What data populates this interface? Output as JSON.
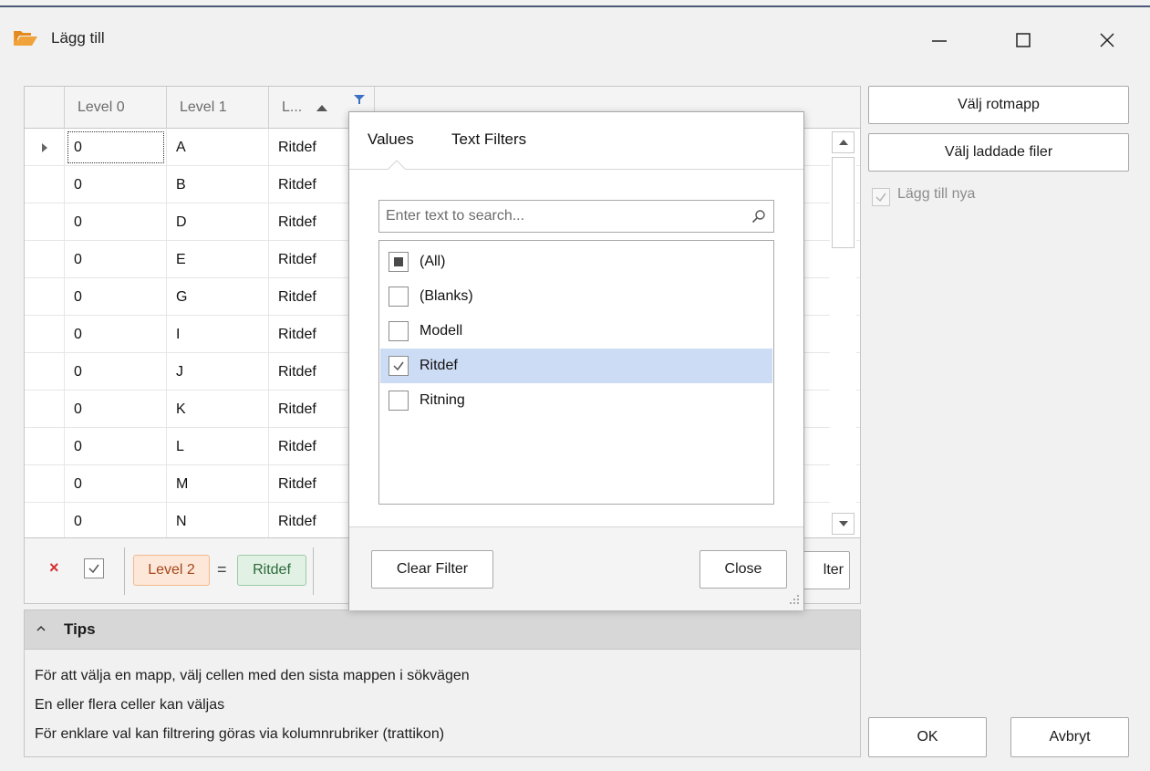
{
  "window": {
    "title": "Lägg till",
    "minimize_glyph": "—",
    "maximize_glyph": "☐",
    "close_glyph": "✕",
    "icon": "folder-open-icon",
    "icon_color": "#f0a33b"
  },
  "grid": {
    "columns": [
      "Level 0",
      "Level 1",
      "L..."
    ],
    "sort_icon": "sort-ascending-icon",
    "filter_icon": "filter-funnel-icon",
    "rows": [
      [
        "0",
        "A",
        "Ritdef"
      ],
      [
        "0",
        "B",
        "Ritdef"
      ],
      [
        "0",
        "D",
        "Ritdef"
      ],
      [
        "0",
        "E",
        "Ritdef"
      ],
      [
        "0",
        "G",
        "Ritdef"
      ],
      [
        "0",
        "I",
        "Ritdef"
      ],
      [
        "0",
        "J",
        "Ritdef"
      ],
      [
        "0",
        "K",
        "Ritdef"
      ],
      [
        "0",
        "L",
        "Ritdef"
      ],
      [
        "0",
        "M",
        "Ritdef"
      ],
      [
        "0",
        "N",
        "Ritdef"
      ]
    ]
  },
  "filter_panel": {
    "clear_glyph": "×",
    "enabled_checked": true,
    "field": "Level 2",
    "operator": "=",
    "value": "Ritdef",
    "edit_button_partial": "lter"
  },
  "tips": {
    "title": "Tips",
    "lines": [
      "För att välja en mapp, välj cellen med den sista mappen i sökvägen",
      "En eller flera celler kan väljas",
      "För enklare val kan filtrering göras via kolumnrubriker (trattikon)"
    ]
  },
  "side": {
    "choose_root": "Välj rotmapp",
    "choose_loaded": "Välj laddade filer",
    "add_new_label": "Lägg till nya",
    "add_new_checked": true,
    "ok": "OK",
    "cancel": "Avbryt"
  },
  "popup": {
    "tab_values": "Values",
    "tab_text_filters": "Text Filters",
    "search_placeholder": "Enter text to search...",
    "search_icon": "search-icon",
    "items": [
      {
        "label": "(All)",
        "state": "indeterminate"
      },
      {
        "label": "(Blanks)",
        "state": "unchecked"
      },
      {
        "label": "Modell",
        "state": "unchecked"
      },
      {
        "label": "Ritdef",
        "state": "checked"
      },
      {
        "label": "Ritning",
        "state": "unchecked"
      }
    ],
    "clear_filter": "Clear Filter",
    "close": "Close"
  },
  "colors": {
    "selection": "#cddcf5",
    "field_chip": "#fde7d8",
    "value_chip": "#e1f1e4",
    "clear_x": "#d23030"
  }
}
